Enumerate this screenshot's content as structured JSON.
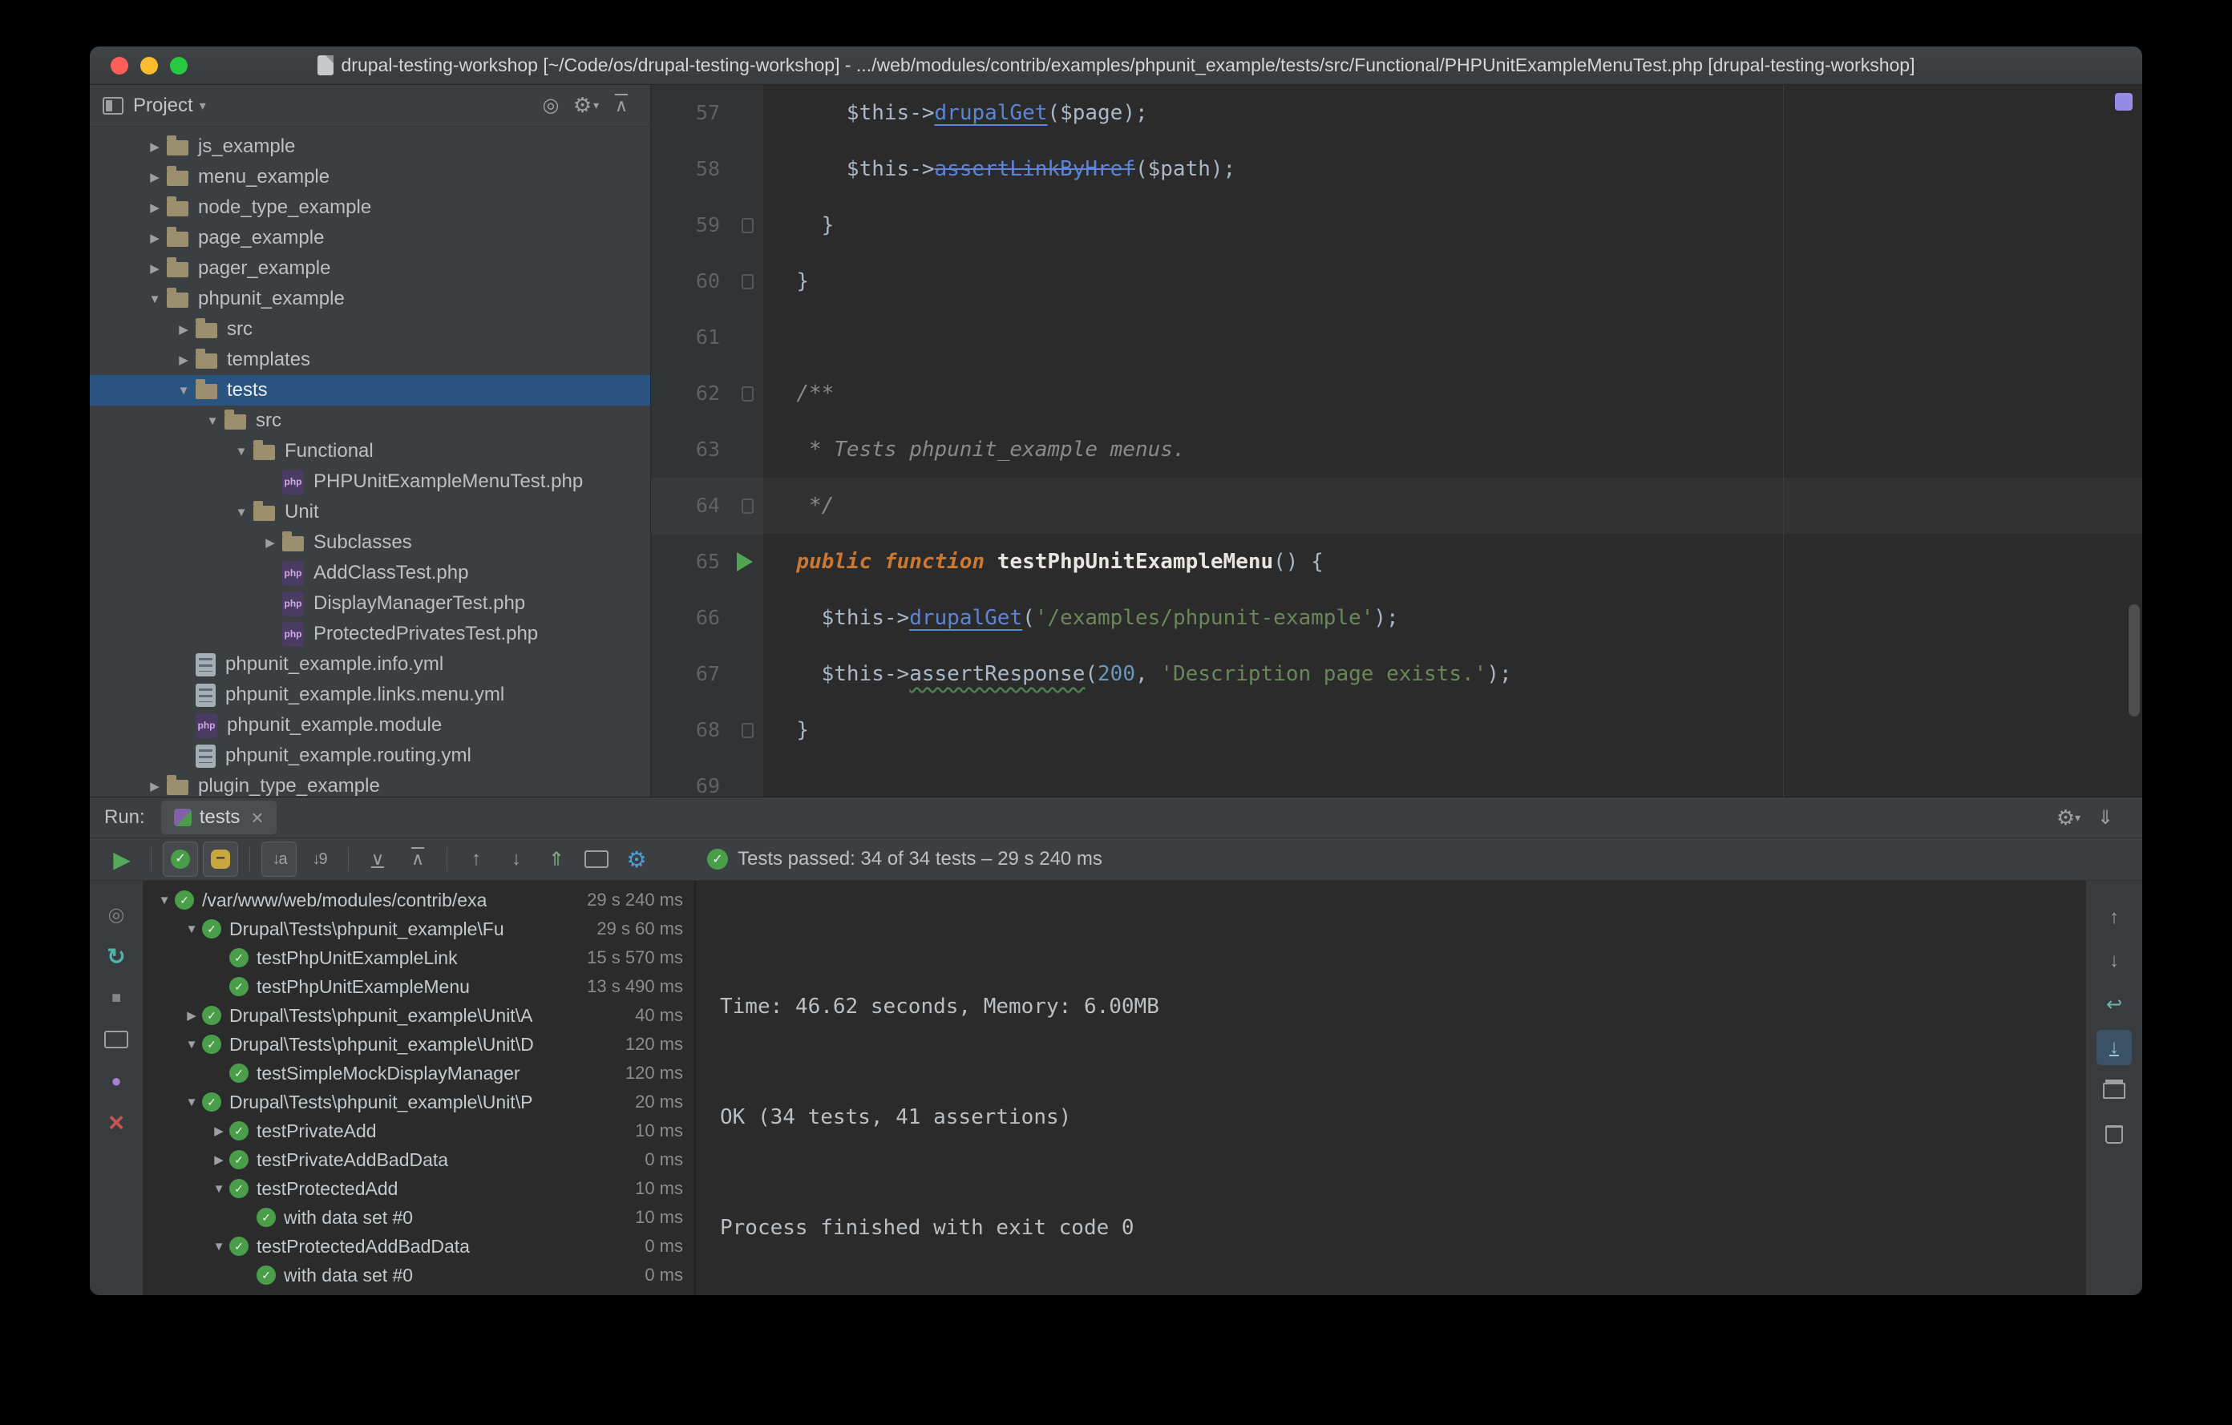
{
  "window": {
    "title": "drupal-testing-workshop [~/Code/os/drupal-testing-workshop] - .../web/modules/contrib/examples/phpunit_example/tests/src/Functional/PHPUnitExampleMenuTest.php [drupal-testing-workshop]"
  },
  "colors": {
    "selection_blue": "#2a5480",
    "pass_green": "#4a9e4a",
    "keyword_orange": "#cc7832",
    "string_green": "#6a8759",
    "method_blue": "#5c85d6",
    "editor_bg": "#2b2b2b",
    "panel_bg": "#3c3f41"
  },
  "project_panel": {
    "title": "Project",
    "header_icons": [
      "select-opened-file-icon",
      "settings-icon",
      "collapse-all-icon"
    ],
    "tree": [
      {
        "label": "js_example",
        "depth": 1,
        "expand": "closed",
        "icon": "folder"
      },
      {
        "label": "menu_example",
        "depth": 1,
        "expand": "closed",
        "icon": "folder"
      },
      {
        "label": "node_type_example",
        "depth": 1,
        "expand": "closed",
        "icon": "folder"
      },
      {
        "label": "page_example",
        "depth": 1,
        "expand": "closed",
        "icon": "folder"
      },
      {
        "label": "pager_example",
        "depth": 1,
        "expand": "closed",
        "icon": "folder"
      },
      {
        "label": "phpunit_example",
        "depth": 1,
        "expand": "open",
        "icon": "folder"
      },
      {
        "label": "src",
        "depth": 2,
        "expand": "closed",
        "icon": "folder"
      },
      {
        "label": "templates",
        "depth": 2,
        "expand": "closed",
        "icon": "folder"
      },
      {
        "label": "tests",
        "depth": 2,
        "expand": "open",
        "icon": "folder",
        "selected": true
      },
      {
        "label": "src",
        "depth": 3,
        "expand": "open",
        "icon": "folder"
      },
      {
        "label": "Functional",
        "depth": 4,
        "expand": "open",
        "icon": "folder"
      },
      {
        "label": "PHPUnitExampleMenuTest.php",
        "depth": 5,
        "expand": "none",
        "icon": "php"
      },
      {
        "label": "Unit",
        "depth": 4,
        "expand": "open",
        "icon": "folder"
      },
      {
        "label": "Subclasses",
        "depth": 5,
        "expand": "closed",
        "icon": "folder"
      },
      {
        "label": "AddClassTest.php",
        "depth": 5,
        "expand": "none",
        "icon": "php"
      },
      {
        "label": "DisplayManagerTest.php",
        "depth": 5,
        "expand": "none",
        "icon": "php"
      },
      {
        "label": "ProtectedPrivatesTest.php",
        "depth": 5,
        "expand": "none",
        "icon": "php"
      },
      {
        "label": "phpunit_example.info.yml",
        "depth": 2,
        "expand": "none",
        "icon": "yml"
      },
      {
        "label": "phpunit_example.links.menu.yml",
        "depth": 2,
        "expand": "none",
        "icon": "yml"
      },
      {
        "label": "phpunit_example.module",
        "depth": 2,
        "expand": "none",
        "icon": "module"
      },
      {
        "label": "phpunit_example.routing.yml",
        "depth": 2,
        "expand": "none",
        "icon": "yml"
      },
      {
        "label": "plugin_type_example",
        "depth": 1,
        "expand": "closed",
        "icon": "folder"
      }
    ]
  },
  "editor": {
    "current_line": 64,
    "lines": [
      {
        "n": 57,
        "gutter": null,
        "tokens": [
          [
            "ind",
            "      "
          ],
          [
            "var",
            "$this"
          ],
          [
            "op",
            "->"
          ],
          [
            "mlink",
            "drupalGet"
          ],
          [
            "par",
            "("
          ],
          [
            "var",
            "$page"
          ],
          [
            "par",
            ");"
          ]
        ]
      },
      {
        "n": 58,
        "gutter": null,
        "tokens": [
          [
            "ind",
            "      "
          ],
          [
            "var",
            "$this"
          ],
          [
            "op",
            "->"
          ],
          [
            "mstrike",
            "assertLinkByHref"
          ],
          [
            "par",
            "("
          ],
          [
            "var",
            "$path"
          ],
          [
            "par",
            ");"
          ]
        ]
      },
      {
        "n": 59,
        "gutter": "mark",
        "tokens": [
          [
            "ind",
            "    "
          ],
          [
            "par",
            "}"
          ]
        ]
      },
      {
        "n": 60,
        "gutter": "mark",
        "tokens": [
          [
            "ind",
            "  "
          ],
          [
            "par",
            "}"
          ]
        ]
      },
      {
        "n": 61,
        "gutter": null,
        "tokens": []
      },
      {
        "n": 62,
        "gutter": "mark",
        "tokens": [
          [
            "ind",
            "  "
          ],
          [
            "com",
            "/**"
          ]
        ]
      },
      {
        "n": 63,
        "gutter": null,
        "tokens": [
          [
            "ind",
            "  "
          ],
          [
            "com",
            " * Tests phpunit_example menus."
          ]
        ]
      },
      {
        "n": 64,
        "gutter": "mark",
        "tokens": [
          [
            "ind",
            "  "
          ],
          [
            "com",
            " */"
          ]
        ]
      },
      {
        "n": 65,
        "gutter": "run",
        "tokens": [
          [
            "ind",
            "  "
          ],
          [
            "kw",
            "public function"
          ],
          [
            "plain",
            " "
          ],
          [
            "fn",
            "testPhpUnitExampleMenu"
          ],
          [
            "par",
            "() {"
          ]
        ]
      },
      {
        "n": 66,
        "gutter": null,
        "tokens": [
          [
            "ind",
            "    "
          ],
          [
            "var",
            "$this"
          ],
          [
            "op",
            "->"
          ],
          [
            "mlink",
            "drupalGet"
          ],
          [
            "par",
            "("
          ],
          [
            "str",
            "'/examples/phpunit-example'"
          ],
          [
            "par",
            ");"
          ]
        ]
      },
      {
        "n": 67,
        "gutter": null,
        "tokens": [
          [
            "ind",
            "    "
          ],
          [
            "var",
            "$this"
          ],
          [
            "op",
            "->"
          ],
          [
            "mwarn",
            "assertResponse"
          ],
          [
            "par",
            "("
          ],
          [
            "num",
            "200"
          ],
          [
            "par",
            ", "
          ],
          [
            "str",
            "'Description page exists.'"
          ],
          [
            "par",
            ");"
          ]
        ]
      },
      {
        "n": 68,
        "gutter": "mark",
        "tokens": [
          [
            "ind",
            "  "
          ],
          [
            "par",
            "}"
          ]
        ]
      },
      {
        "n": 69,
        "gutter": null,
        "tokens": []
      }
    ]
  },
  "run_panel": {
    "label": "Run:",
    "tab": {
      "title": "tests",
      "close": "×"
    },
    "header_icons": [
      "settings-gear-icon",
      "hide-panel-icon"
    ],
    "toolbar_icons": [
      "rerun-tests-icon",
      "separator",
      "show-passed-icon",
      "show-ignored-icon",
      "separator",
      "sort-alphabetically-icon",
      "sort-by-duration-icon",
      "separator",
      "expand-all-icon",
      "collapse-all2-icon",
      "separator",
      "previous-occurrence-icon",
      "next-occurrence-icon",
      "import-test-results-icon",
      "coverage-icon",
      "test-settings-icon"
    ],
    "status": "Tests passed: 34 of 34 tests – 29 s 240 ms",
    "left_icons": [
      "rerun-icon",
      "rerun-failed-tests-icon",
      "stop-icon",
      "show-console-icon",
      "pin-tab-icon",
      "close-run-icon"
    ],
    "right_icons": [
      "scroll-up-icon",
      "scroll-down-icon",
      "soft-wrap-icon",
      "scroll-to-end-icon",
      "print-icon",
      "clear-all-icon"
    ],
    "tree": [
      {
        "label": "/var/www/web/modules/contrib/exa",
        "duration": "29 s 240 ms",
        "depth": 0,
        "expand": "open"
      },
      {
        "label": "Drupal\\Tests\\phpunit_example\\Fu",
        "duration": "29 s 60 ms",
        "depth": 1,
        "expand": "open"
      },
      {
        "label": "testPhpUnitExampleLink",
        "duration": "15 s 570 ms",
        "depth": 2,
        "expand": "none"
      },
      {
        "label": "testPhpUnitExampleMenu",
        "duration": "13 s 490 ms",
        "depth": 2,
        "expand": "none"
      },
      {
        "label": "Drupal\\Tests\\phpunit_example\\Unit\\A",
        "duration": "40 ms",
        "depth": 1,
        "expand": "closed"
      },
      {
        "label": "Drupal\\Tests\\phpunit_example\\Unit\\D",
        "duration": "120 ms",
        "depth": 1,
        "expand": "open"
      },
      {
        "label": "testSimpleMockDisplayManager",
        "duration": "120 ms",
        "depth": 2,
        "expand": "none"
      },
      {
        "label": "Drupal\\Tests\\phpunit_example\\Unit\\P",
        "duration": "20 ms",
        "depth": 1,
        "expand": "open"
      },
      {
        "label": "testPrivateAdd",
        "duration": "10 ms",
        "depth": 2,
        "expand": "closed"
      },
      {
        "label": "testPrivateAddBadData",
        "duration": "0 ms",
        "depth": 2,
        "expand": "closed"
      },
      {
        "label": "testProtectedAdd",
        "duration": "10 ms",
        "depth": 2,
        "expand": "open"
      },
      {
        "label": "with data set #0",
        "duration": "10 ms",
        "depth": 3,
        "expand": "none"
      },
      {
        "label": "testProtectedAddBadData",
        "duration": "0 ms",
        "depth": 2,
        "expand": "open"
      },
      {
        "label": "with data set #0",
        "duration": "0 ms",
        "depth": 3,
        "expand": "none"
      }
    ],
    "console": [
      "Time: 46.62 seconds, Memory: 6.00MB",
      "",
      "",
      "OK (34 tests, 41 assertions)",
      "",
      "",
      "Process finished with exit code 0"
    ]
  }
}
